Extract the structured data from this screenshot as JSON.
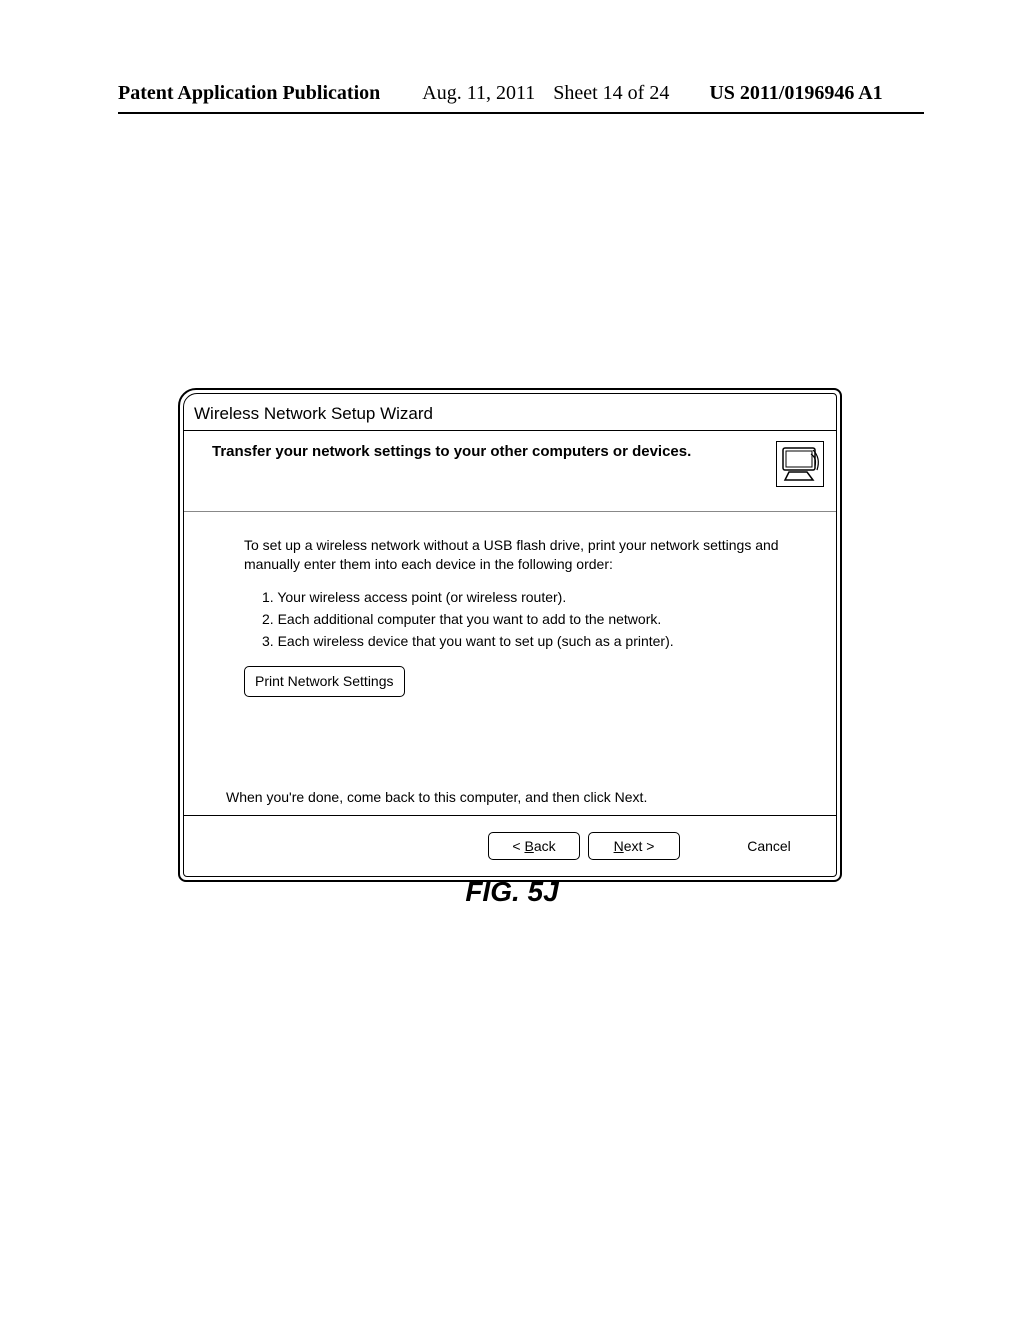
{
  "header": {
    "pub": "Patent Application Publication",
    "date": "Aug. 11, 2011",
    "sheet": "Sheet 14 of 24",
    "docnum": "US 2011/0196946 A1"
  },
  "wizard": {
    "title": "Wireless Network Setup Wizard",
    "heading": "Transfer your network settings to your other computers or devices.",
    "intro": "To set up a wireless network without a USB flash drive, print your network settings and manually enter them into each device in the following order:",
    "steps": {
      "s1": "1.  Your wireless access point (or wireless router).",
      "s2": "2.  Each additional computer that you want to add to the network.",
      "s3": "3.  Each wireless device that you want to set up (such as a printer)."
    },
    "print_label": "Print Network Settings",
    "done_text": "When you're done, come back to this computer, and then click Next.",
    "buttons": {
      "back_prefix": "< ",
      "back_u": "B",
      "back_rest": "ack",
      "next_u": "N",
      "next_rest": "ext >",
      "cancel": "Cancel"
    }
  },
  "figure_caption": "FIG. 5J"
}
